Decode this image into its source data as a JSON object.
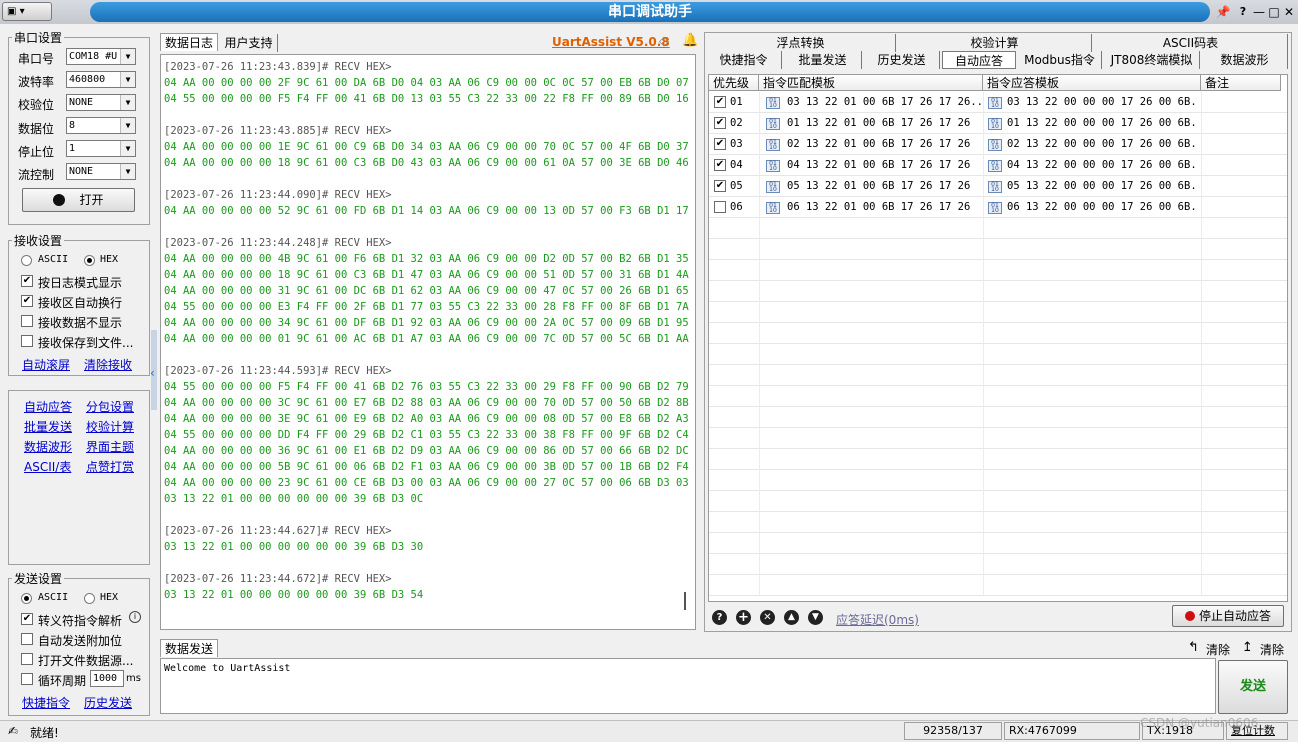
{
  "title": "串口调试助手",
  "serial": {
    "title": "串口设置",
    "port_label": "串口号",
    "port": "COM18 #U",
    "baud_label": "波特率",
    "baud": "460800",
    "parity_label": "校验位",
    "parity": "NONE",
    "data_label": "数据位",
    "data": "8",
    "stop_label": "停止位",
    "stop": "1",
    "flow_label": "流控制",
    "flow": "NONE",
    "open": "打开"
  },
  "recv": {
    "title": "接收设置",
    "ascii": "ASCII",
    "hex": "HEX",
    "opt1": "按日志模式显示",
    "opt2": "接收区自动换行",
    "opt3": "接收数据不显示",
    "opt4": "接收保存到文件...",
    "link1": "自动滚屏",
    "link2": "清除接收"
  },
  "tools": [
    "自动应答",
    "分包设置",
    "批量发送",
    "校验计算",
    "数据波形",
    "界面主题",
    "ASCII/表",
    "点赞打赏"
  ],
  "send": {
    "title": "发送设置",
    "ascii": "ASCII",
    "hex": "HEX",
    "opt1": "转义符指令解析",
    "opt2": "自动发送附加位",
    "opt3": "打开文件数据源...",
    "opt4": "循环周期",
    "period": "1000",
    "unit": "ms",
    "link1": "快捷指令",
    "link2": "历史发送"
  },
  "log_tabs": {
    "tab1": "数据日志",
    "tab2": "用户支持",
    "brand": "UartAssist V5.0.8"
  },
  "log": [
    {
      "ts": "[2023-07-26 11:23:43.839]# RECV HEX>",
      "lines": [
        "04 AA 00 00 00 00 2F 9C 61 00 DA 6B D0 04 03 AA 06 C9 00 00 0C 0C 57 00 EB 6B D0 07",
        "04 55 00 00 00 00 F5 F4 FF 00 41 6B D0 13 03 55 C3 22 33 00 22 F8 FF 00 89 6B D0 16"
      ]
    },
    {
      "ts": "[2023-07-26 11:23:43.885]# RECV HEX>",
      "lines": [
        "04 AA 00 00 00 00 1E 9C 61 00 C9 6B D0 34 03 AA 06 C9 00 00 70 0C 57 00 4F 6B D0 37",
        "04 AA 00 00 00 00 18 9C 61 00 C3 6B D0 43 03 AA 06 C9 00 00 61 0A 57 00 3E 6B D0 46"
      ]
    },
    {
      "ts": "[2023-07-26 11:23:44.090]# RECV HEX>",
      "lines": [
        "04 AA 00 00 00 00 52 9C 61 00 FD 6B D1 14 03 AA 06 C9 00 00 13 0D 57 00 F3 6B D1 17"
      ]
    },
    {
      "ts": "[2023-07-26 11:23:44.248]# RECV HEX>",
      "lines": [
        "04 AA 00 00 00 00 4B 9C 61 00 F6 6B D1 32 03 AA 06 C9 00 00 D2 0D 57 00 B2 6B D1 35",
        "04 AA 00 00 00 00 18 9C 61 00 C3 6B D1 47 03 AA 06 C9 00 00 51 0D 57 00 31 6B D1 4A",
        "04 AA 00 00 00 00 31 9C 61 00 DC 6B D1 62 03 AA 06 C9 00 00 47 0C 57 00 26 6B D1 65",
        "04 55 00 00 00 00 E3 F4 FF 00 2F 6B D1 77 03 55 C3 22 33 00 28 F8 FF 00 8F 6B D1 7A",
        "04 AA 00 00 00 00 34 9C 61 00 DF 6B D1 92 03 AA 06 C9 00 00 2A 0C 57 00 09 6B D1 95",
        "04 AA 00 00 00 00 01 9C 61 00 AC 6B D1 A7 03 AA 06 C9 00 00 7C 0D 57 00 5C 6B D1 AA"
      ]
    },
    {
      "ts": "[2023-07-26 11:23:44.593]# RECV HEX>",
      "lines": [
        "04 55 00 00 00 00 F5 F4 FF 00 41 6B D2 76 03 55 C3 22 33 00 29 F8 FF 00 90 6B D2 79",
        "04 AA 00 00 00 00 3C 9C 61 00 E7 6B D2 88 03 AA 06 C9 00 00 70 0D 57 00 50 6B D2 8B",
        "04 AA 00 00 00 00 3E 9C 61 00 E9 6B D2 A0 03 AA 06 C9 00 00 08 0D 57 00 E8 6B D2 A3",
        "04 55 00 00 00 00 DD F4 FF 00 29 6B D2 C1 03 55 C3 22 33 00 38 F8 FF 00 9F 6B D2 C4",
        "04 AA 00 00 00 00 36 9C 61 00 E1 6B D2 D9 03 AA 06 C9 00 00 86 0D 57 00 66 6B D2 DC",
        "04 AA 00 00 00 00 5B 9C 61 00 06 6B D2 F1 03 AA 06 C9 00 00 3B 0D 57 00 1B 6B D2 F4",
        "04 AA 00 00 00 00 23 9C 61 00 CE 6B D3 00 03 AA 06 C9 00 00 27 0C 57 00 06 6B D3 03",
        "03 13 22 01 00 00 00 00 00 00 39 6B D3 0C"
      ]
    },
    {
      "ts": "[2023-07-26 11:23:44.627]# RECV HEX>",
      "lines": [
        "03 13 22 01 00 00 00 00 00 00 39 6B D3 30"
      ]
    },
    {
      "ts": "[2023-07-26 11:23:44.672]# RECV HEX>",
      "lines": [
        "03 13 22 01 00 00 00 00 00 00 39 6B D3 54"
      ]
    }
  ],
  "right_tabs_top": [
    "浮点转换",
    "校验计算",
    "ASCII码表"
  ],
  "right_tabs": [
    "快捷指令",
    "批量发送",
    "历史发送",
    "自动应答",
    "Modbus指令",
    "JT808终端模拟",
    "数据波形"
  ],
  "table": {
    "headers": [
      "优先级",
      "指令匹配模板",
      "指令应答模板",
      "备注"
    ],
    "rows": [
      {
        "checked": true,
        "pri": "01",
        "match": "03 13 22 01 00 6B 17 26 17 26...",
        "reply": "03 13 22 00 00 00 17 26 00 6B..."
      },
      {
        "checked": true,
        "pri": "02",
        "match": "01 13 22 01 00 6B 17 26 17 26",
        "reply": "01 13 22 00 00 00 17 26 00 6B..."
      },
      {
        "checked": true,
        "pri": "03",
        "match": "02 13 22 01 00 6B 17 26 17 26",
        "reply": "02 13 22 00 00 00 17 26 00 6B..."
      },
      {
        "checked": true,
        "pri": "04",
        "match": "04 13 22 01 00 6B 17 26 17 26",
        "reply": "04 13 22 00 00 00 17 26 00 6B..."
      },
      {
        "checked": true,
        "pri": "05",
        "match": "05 13 22 01 00 6B 17 26 17 26",
        "reply": "05 13 22 00 00 00 17 26 00 6B..."
      },
      {
        "checked": false,
        "pri": "06",
        "match": "06 13 22 01 00 6B 17 26 17 26",
        "reply": "06 13 22 00 00 00 17 26 00 6B..."
      }
    ]
  },
  "reply_delay": "应答延迟(0ms)",
  "stop_auto": "停止自动应答",
  "send_area": {
    "tab": "数据发送",
    "clear1": "清除",
    "clear2": "清除",
    "text": "Welcome to UartAssist",
    "send": "发送"
  },
  "status": {
    "ready": "就绪!",
    "counts": "92358/137",
    "rx": "RX:4767099",
    "tx": "TX:1918",
    "reset": "复位计数",
    "watermark": "CSDN @yutian0606"
  }
}
